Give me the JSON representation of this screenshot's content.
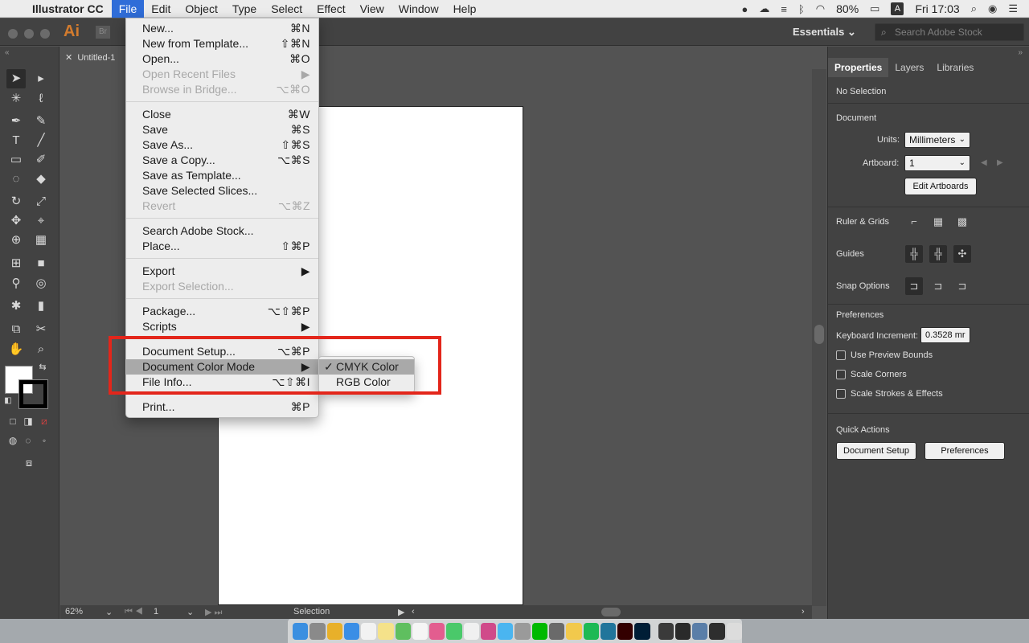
{
  "menubar": {
    "app_name": "Illustrator CC",
    "menus": [
      "File",
      "Edit",
      "Object",
      "Type",
      "Select",
      "Effect",
      "View",
      "Window",
      "Help"
    ],
    "battery": "80%",
    "input_source": "A",
    "clock": "Fri 17:03"
  },
  "appbar": {
    "app_logo": "Ai",
    "bridge_logo": "Br",
    "workspace": "Essentials",
    "search_placeholder": "Search Adobe Stock"
  },
  "document": {
    "tab_title": "Untitled-1",
    "zoom": "62%",
    "artboard_number": "1",
    "status_tool": "Selection"
  },
  "file_menu": {
    "items": [
      {
        "label": "New...",
        "shortcut": "⌘N",
        "enabled": true
      },
      {
        "label": "New from Template...",
        "shortcut": "⇧⌘N",
        "enabled": true
      },
      {
        "label": "Open...",
        "shortcut": "⌘O",
        "enabled": true
      },
      {
        "label": "Open Recent Files",
        "shortcut": "▶",
        "enabled": false
      },
      {
        "label": "Browse in Bridge...",
        "shortcut": "⌥⌘O",
        "enabled": false
      },
      {
        "label": "Close",
        "shortcut": "⌘W",
        "enabled": true
      },
      {
        "label": "Save",
        "shortcut": "⌘S",
        "enabled": true
      },
      {
        "label": "Save As...",
        "shortcut": "⇧⌘S",
        "enabled": true
      },
      {
        "label": "Save a Copy...",
        "shortcut": "⌥⌘S",
        "enabled": true
      },
      {
        "label": "Save as Template...",
        "shortcut": "",
        "enabled": true
      },
      {
        "label": "Save Selected Slices...",
        "shortcut": "",
        "enabled": true
      },
      {
        "label": "Revert",
        "shortcut": "⌥⌘Z",
        "enabled": false
      },
      {
        "label": "Search Adobe Stock...",
        "shortcut": "",
        "enabled": true
      },
      {
        "label": "Place...",
        "shortcut": "⇧⌘P",
        "enabled": true
      },
      {
        "label": "Export",
        "shortcut": "▶",
        "enabled": true
      },
      {
        "label": "Export Selection...",
        "shortcut": "",
        "enabled": false
      },
      {
        "label": "Package...",
        "shortcut": "⌥⇧⌘P",
        "enabled": true
      },
      {
        "label": "Scripts",
        "shortcut": "▶",
        "enabled": true
      },
      {
        "label": "Document Setup...",
        "shortcut": "⌥⌘P",
        "enabled": true
      },
      {
        "label": "Document Color Mode",
        "shortcut": "▶",
        "enabled": true
      },
      {
        "label": "File Info...",
        "shortcut": "⌥⇧⌘I",
        "enabled": true
      },
      {
        "label": "Print...",
        "shortcut": "⌘P",
        "enabled": true
      }
    ]
  },
  "color_mode_submenu": {
    "items": [
      {
        "label": "CMYK Color",
        "checked": true
      },
      {
        "label": "RGB Color",
        "checked": false
      }
    ]
  },
  "properties_panel": {
    "tabs": [
      "Properties",
      "Layers",
      "Libraries"
    ],
    "selection_state": "No Selection",
    "document_title": "Document",
    "units_label": "Units:",
    "units_value": "Millimeters",
    "artboard_label": "Artboard:",
    "artboard_value": "1",
    "edit_artboards": "Edit Artboards",
    "ruler_grids": "Ruler & Grids",
    "guides": "Guides",
    "snap_options": "Snap Options",
    "preferences_title": "Preferences",
    "keyboard_increment_label": "Keyboard Increment:",
    "keyboard_increment_value": "0.3528 mr",
    "use_preview_bounds": "Use Preview Bounds",
    "scale_corners": "Scale Corners",
    "scale_strokes": "Scale Strokes & Effects",
    "quick_actions": "Quick Actions",
    "document_setup_btn": "Document Setup",
    "preferences_btn": "Preferences"
  },
  "colors": {
    "menubar_highlight": "#2f6dd8",
    "annotation_red": "#e3261b",
    "ai_orange": "#d27b2e"
  }
}
